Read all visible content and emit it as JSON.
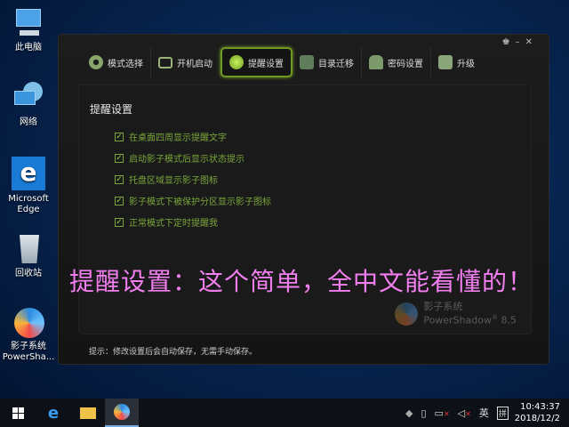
{
  "desktop": {
    "icons": [
      {
        "label": "此电脑",
        "icon": "computer-icon"
      },
      {
        "label": "网络",
        "icon": "network-icon"
      },
      {
        "label": "Microsoft Edge",
        "icon": "edge-icon"
      },
      {
        "label": "回收站",
        "icon": "recycle-bin-icon"
      },
      {
        "label": "影子系统 PowerSha...",
        "icon": "powershadow-icon"
      }
    ]
  },
  "window": {
    "controls": [
      "skin",
      "minimize",
      "close"
    ],
    "tabs": [
      {
        "label": "模式选择",
        "icon": "gear-icon"
      },
      {
        "label": "开机启动",
        "icon": "monitor-icon"
      },
      {
        "label": "提醒设置",
        "icon": "bulb-icon",
        "active": true
      },
      {
        "label": "目录迁移",
        "icon": "folder-icon"
      },
      {
        "label": "密码设置",
        "icon": "lock-icon"
      },
      {
        "label": "升级",
        "icon": "upgrade-icon"
      }
    ],
    "panel_title": "提醒设置",
    "options": [
      {
        "label": "在桌面四周显示提醒文字",
        "checked": true
      },
      {
        "label": "启动影子模式后显示状态提示",
        "checked": true
      },
      {
        "label": "托盘区域显示影子图标",
        "checked": true
      },
      {
        "label": "影子模式下被保护分区显示影子图标",
        "checked": true
      },
      {
        "label": "正常模式下定时提醒我",
        "checked": true
      }
    ],
    "brand": {
      "name": "影子系统",
      "product": "PowerShadow",
      "version": "8.5",
      "reg": "®"
    },
    "hint": "提示：修改设置后会自动保存，无需手动保存。"
  },
  "overlay_text": "提醒设置：这个简单，全中文能看懂的！",
  "taskbar": {
    "ime": "英",
    "ime2": "拼",
    "time": "10:43:37",
    "date": "2018/12/2"
  }
}
